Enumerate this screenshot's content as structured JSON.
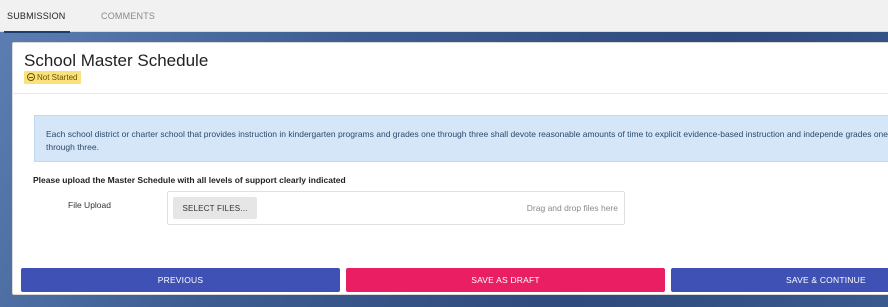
{
  "tabs": {
    "submission": "SUBMISSION",
    "comments": "COMMENTS"
  },
  "page": {
    "title": "School Master Schedule",
    "status": "Not Started",
    "status_color": "#fbe17b"
  },
  "info": {
    "text": "Each school district or charter school that provides instruction in kindergarten programs and grades one through three shall devote reasonable amounts of time to explicit evidence-based instruction and independe grades one through three."
  },
  "upload": {
    "heading": "Please upload the Master Schedule with all levels of support clearly indicated",
    "label": "File Upload",
    "select_button": "SELECT FILES...",
    "drop_hint": "Drag and drop files here"
  },
  "actions": {
    "previous": "PREVIOUS",
    "save_draft": "SAVE AS DRAFT",
    "save_continue": "SAVE & CONTINUE",
    "primary_color": "#3f51b5",
    "draft_color": "#e91e63"
  }
}
